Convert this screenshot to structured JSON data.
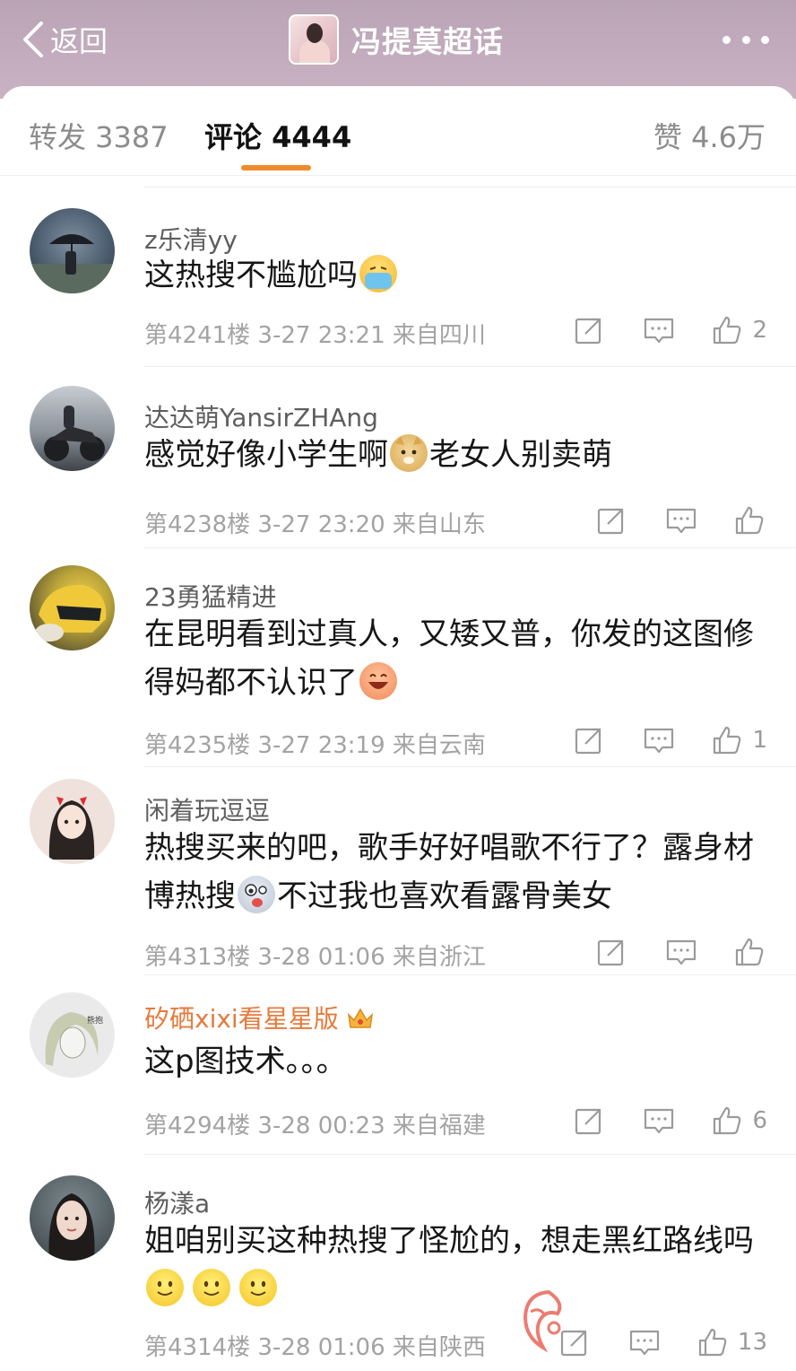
{
  "header": {
    "back_label": "返回",
    "title": "冯提莫超话"
  },
  "tabs": {
    "repost": "转发 3387",
    "comment": "评论 4444",
    "like": "赞 4.6万"
  },
  "comments": [
    {
      "user": "z乐清yy",
      "text": "这热搜不尴尬吗",
      "emoji": [
        "cold-sweat-emoji"
      ],
      "floor": "第4241楼 3-27 23:21 来自四川",
      "likes": "2"
    },
    {
      "user": "达达萌YansirZHAng",
      "text_a": "感觉好像小学生啊",
      "text_b": "老女人别卖萌",
      "emoji": [
        "doge-emoji"
      ],
      "floor": "第4238楼 3-27 23:20 来自山东",
      "likes": ""
    },
    {
      "user": "23勇猛精进",
      "text": "在昆明看到过真人，又矮又普，你发的这图修得妈都不认识了",
      "emoji": [
        "laughing-emoji"
      ],
      "floor": "第4235楼 3-27 23:19 来自云南",
      "likes": "1"
    },
    {
      "user": "闲着玩逗逗",
      "text_a": "热搜买来的吧，歌手好好唱歌不行了？露身材博热搜",
      "text_b": "不过我也喜欢看露骨美女",
      "emoji": [
        "silly-face-emoji"
      ],
      "floor": "第4313楼 3-28 01:06 来自浙江",
      "likes": ""
    },
    {
      "user": "矽硒xixi看星星版",
      "text": "这p图技术。。。",
      "emoji": [],
      "floor": "第4294楼 3-28 00:23 来自福建",
      "likes": "6"
    },
    {
      "user": "杨漾a",
      "text": "姐咱别买这种热搜了怪尬的，想走黑红路线吗",
      "emoji": [
        "smile-emoji",
        "smile-emoji",
        "smile-emoji"
      ],
      "floor": "第4314楼 3-28 01:06 来自陕西",
      "likes": "13"
    }
  ],
  "colors": {
    "header_bg": "#bfa9bc",
    "tab_underline": "#f08a2c",
    "vip_name": "#e7793b"
  }
}
